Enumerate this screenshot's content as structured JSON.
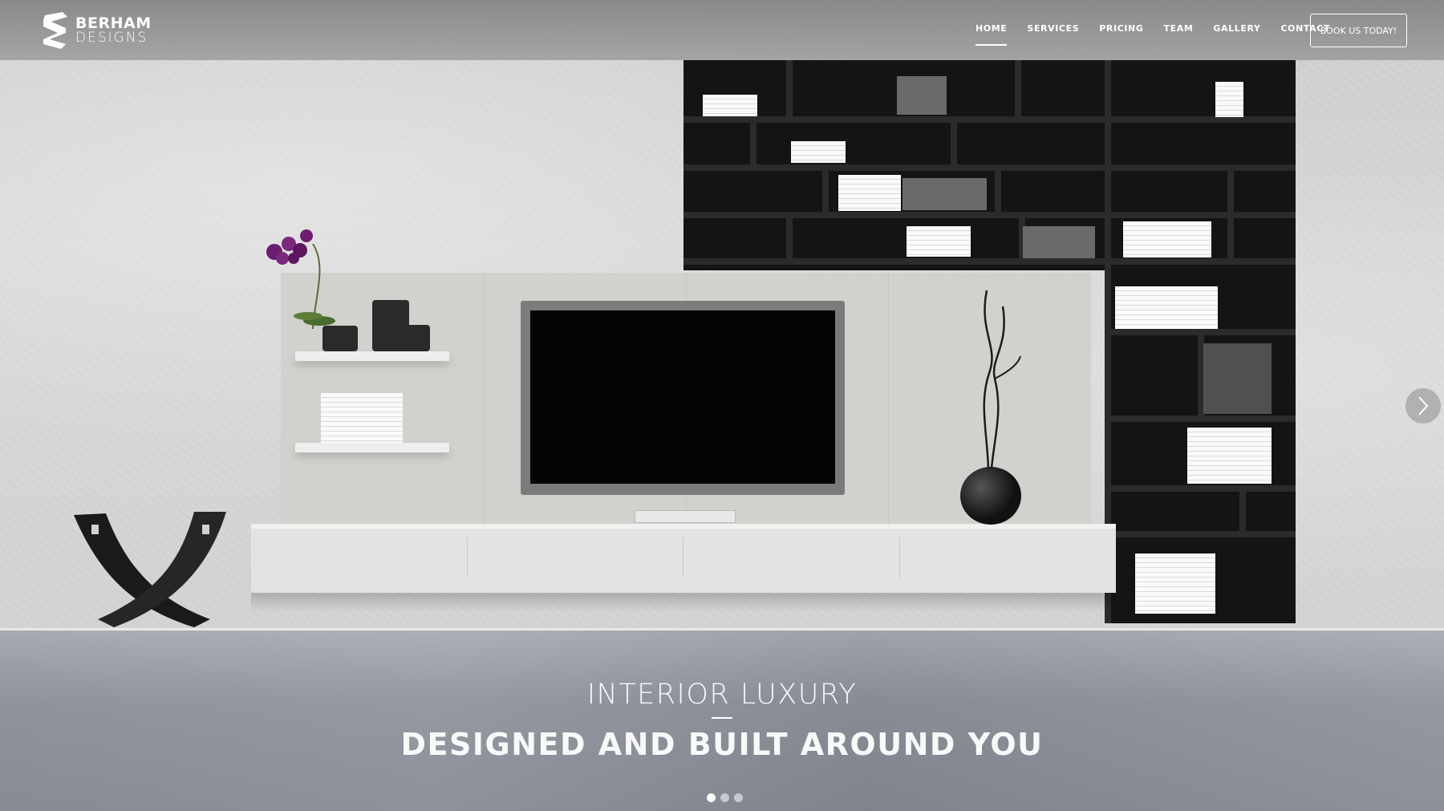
{
  "brand": {
    "line1": "BERHAM",
    "line2": "DESIGNS"
  },
  "nav": {
    "items": [
      {
        "label": "HOME",
        "active": true
      },
      {
        "label": "SERVICES",
        "active": false
      },
      {
        "label": "PRICING",
        "active": false
      },
      {
        "label": "TEAM",
        "active": false
      },
      {
        "label": "GALLERY",
        "active": false
      },
      {
        "label": "CONTACT",
        "active": false
      }
    ],
    "cta_label": "BOOK US TODAY!"
  },
  "slider": {
    "headline_top": "INTERIOR LUXURY",
    "headline_main": "DESIGNED AND BUILT AROUND YOU",
    "slides_total": 3,
    "active_slide": 1,
    "next_icon": "chevron-right-icon"
  },
  "colors": {
    "header_overlay": "#7a7a7a",
    "floor": "#8e939c",
    "accent": "#ffffff"
  }
}
